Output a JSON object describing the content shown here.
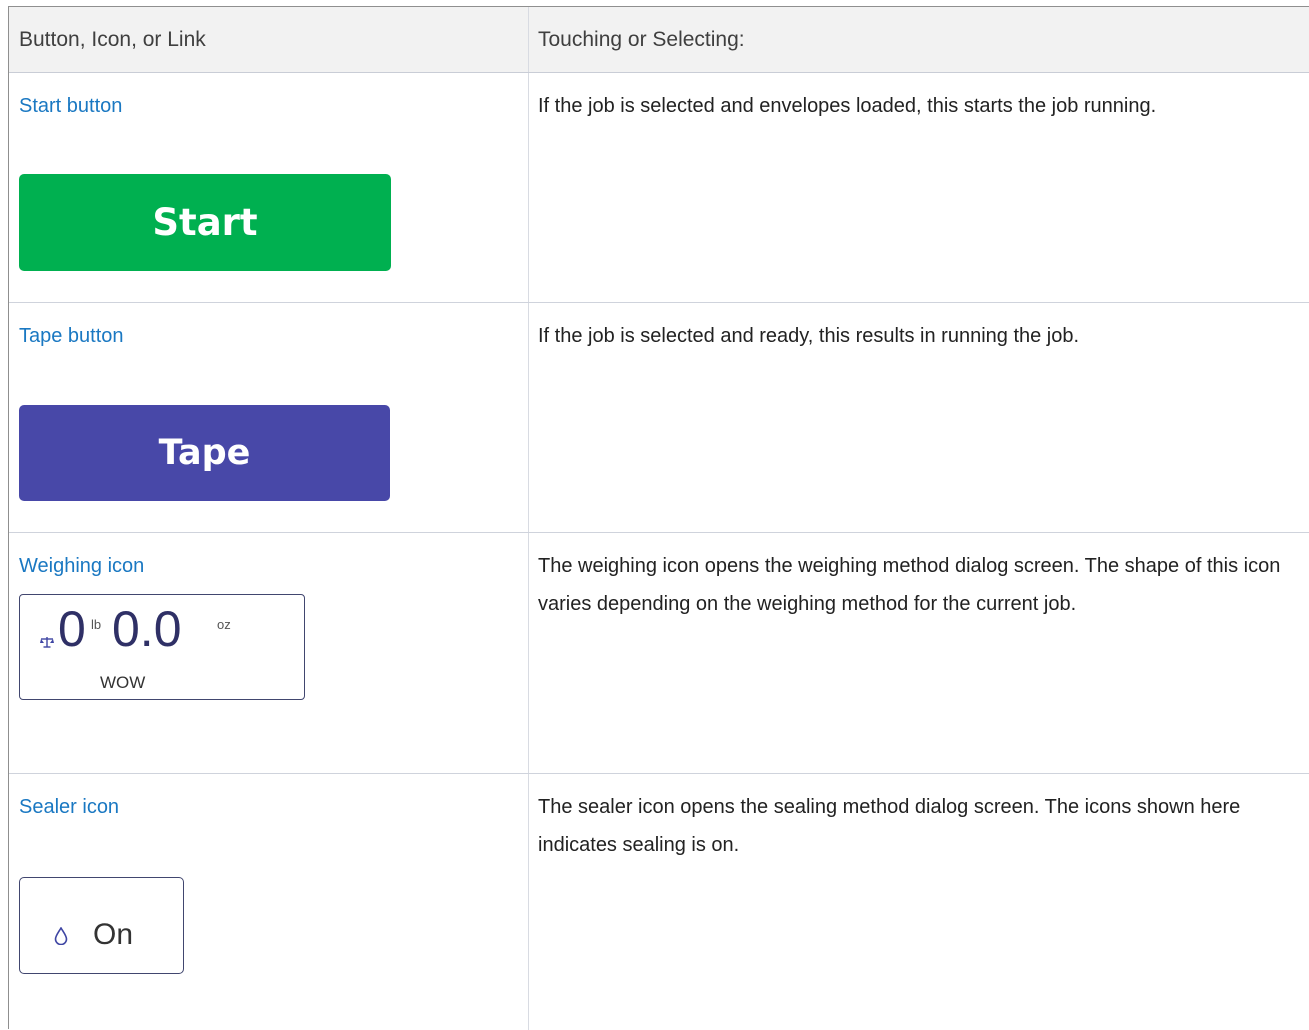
{
  "header": {
    "col1": "Button, Icon, or Link",
    "col2": "Touching or Selecting:"
  },
  "rows": [
    {
      "name": "Start button",
      "description": "If the job is selected and envelopes loaded, this starts the job running.",
      "button_label": "Start",
      "button_color": "#00b050"
    },
    {
      "name": "Tape button",
      "description": "If the job is selected and ready, this results in running the job.",
      "button_label": "Tape",
      "button_color": "#4848a8"
    },
    {
      "name": "Weighing icon",
      "description": "The weighing icon opens the weighing method dialog screen. The shape of this icon varies depending on the weighing method for the current job.",
      "icon": {
        "pounds": "0",
        "pounds_unit": "lb",
        "ounces": "0.0",
        "ounces_unit": "oz",
        "method": "WOW",
        "glyph": "scale-icon"
      }
    },
    {
      "name": "Sealer icon",
      "description": "The sealer icon opens the sealing method dialog screen. The icons shown here indicates sealing is on.",
      "icon": {
        "state": "On",
        "glyph": "water-drop-icon"
      }
    }
  ],
  "colors": {
    "link": "#1a78c2",
    "icon_border": "#41466f"
  }
}
